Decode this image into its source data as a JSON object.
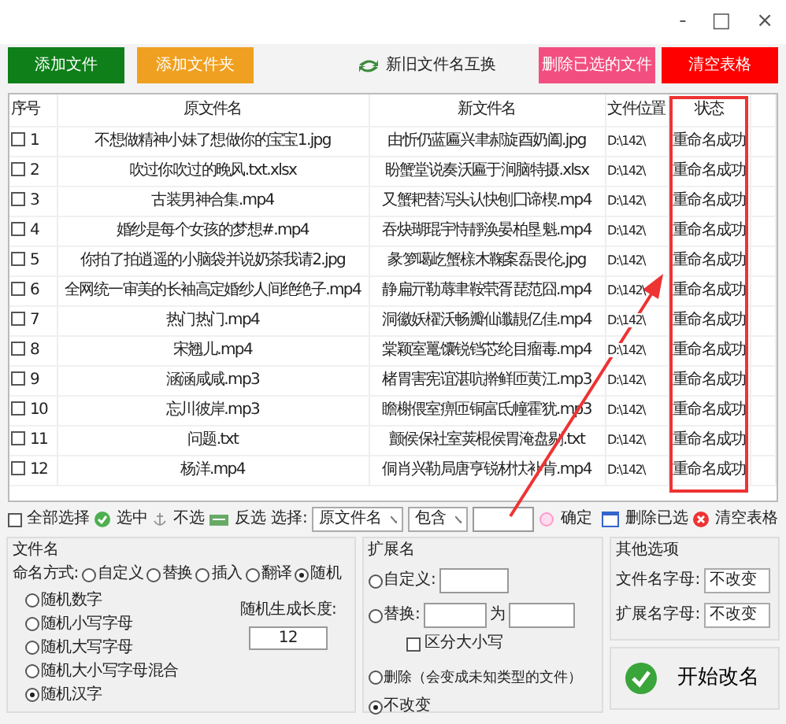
{
  "window": {
    "controls": [
      "-",
      "□",
      "×"
    ]
  },
  "top_buttons": [
    {
      "label": "添加文件",
      "kind": "green"
    },
    {
      "label": "添加文件夹",
      "kind": "orange"
    },
    {
      "label": "新旧文件名互换",
      "kind": "swap"
    },
    {
      "label": "删除已选的文件",
      "kind": "pink"
    },
    {
      "label": "清空表格",
      "kind": "red"
    }
  ],
  "table": {
    "columns": [
      "序号",
      "原文件名",
      "新文件名",
      "文件位置",
      "状态"
    ],
    "rows": [
      {
        "no": "1",
        "checked": false,
        "old": "不想做精神小妹了想做你的宝宝1.jpg",
        "new": "由忻仍蓝匾兴聿郝旋酉奶阖.jpg",
        "path": "D:\\142\\",
        "status": "重命名成功"
      },
      {
        "no": "2",
        "checked": false,
        "old": "吹过你吹过的晚风.txt.xlsx",
        "new": "盼蟹堂说奏沃匾于涧脑特摄.xlsx",
        "path": "D:\\142\\",
        "status": "重命名成功"
      },
      {
        "no": "3",
        "checked": false,
        "old": "古装男神合集.mp4",
        "new": "又蟹耙替泻头认快刨囗谛楔.mp4",
        "path": "D:\\142\\",
        "status": "重命名成功"
      },
      {
        "no": "4",
        "checked": false,
        "old": "婚纱是每个女孩的梦想#.mp4",
        "new": "吞炔瑚琨宇恃靜涣晏柏垦魁.mp4",
        "path": "D:\\142\\",
        "status": "重命名成功"
      },
      {
        "no": "5",
        "checked": false,
        "old": "你拍了拍逍遥的小脑袋并说奶茶我请2.jpg",
        "new": "彖箩噶屹蟹榇木鞠案磊畏伦.jpg",
        "path": "D:\\142\\",
        "status": "重命名成功"
      },
      {
        "no": "6",
        "checked": false,
        "old": "全网统一审美的长袖高定婚纱人间绝绝子.mp4",
        "new": "静扁亓勒蓐聿鞍茕胥琵范囧.mp4",
        "path": "D:\\142\\",
        "status": "重命名成功"
      },
      {
        "no": "7",
        "checked": false,
        "old": "热门热门.mp4",
        "new": "洞徽妖櫂沃畅瓣仙谶靚亿佳.mp4",
        "path": "D:\\142\\",
        "status": "重命名成功"
      },
      {
        "no": "8",
        "checked": false,
        "old": "宋翘儿.mp4",
        "new": "棠颖室鼍馕锐铛芯纶目瘤毒.mp4",
        "path": "D:\\142\\",
        "status": "重命名成功"
      },
      {
        "no": "9",
        "checked": false,
        "old": "涵涵咸咸.mp3",
        "new": "楮胃害宪谊湛吭擀鲜匝黄江.mp3",
        "path": "D:\\142\\",
        "status": "重命名成功"
      },
      {
        "no": "10",
        "checked": false,
        "old": "忘川彼岸.mp3",
        "new": "瞻榭偎室痹匝铜富氐幢霍犹.mp3",
        "path": "D:\\142\\",
        "status": "重命名成功"
      },
      {
        "no": "11",
        "checked": false,
        "old": "问题.txt",
        "new": "颤侯保社室荚棍侯胃淹盘剔.txt",
        "path": "D:\\142\\",
        "status": "重命名成功"
      },
      {
        "no": "12",
        "checked": false,
        "old": "杨洋.mp4",
        "new": "侗肖兴勒局唐亨锐材忕补肯.mp4",
        "path": "D:\\142\\",
        "status": "重命名成功"
      }
    ]
  },
  "toolbar": {
    "select_all": {
      "label": "全部选择",
      "checked": false
    },
    "check": "选中",
    "uncheck": "不选",
    "invert": "反选",
    "select_label": "选择:",
    "field_select": "原文件名",
    "match_select": "包含",
    "confirm": "确定",
    "delete_selected": "删除已选",
    "clear_table": "清空表格"
  },
  "filename": {
    "title": "文件名",
    "mode_label": "命名方式:",
    "modes": [
      {
        "label": "自定义",
        "selected": false
      },
      {
        "label": "替换",
        "selected": false
      },
      {
        "label": "插入",
        "selected": false
      },
      {
        "label": "翻译",
        "selected": false
      },
      {
        "label": "随机",
        "selected": true
      }
    ],
    "random_types": [
      {
        "label": "随机数字",
        "selected": false
      },
      {
        "label": "随机小写字母",
        "selected": false
      },
      {
        "label": "随机大写字母",
        "selected": false
      },
      {
        "label": "随机大小写字母混合",
        "selected": false
      },
      {
        "label": "随机汉字",
        "selected": true
      }
    ],
    "length_label": "随机生成长度:",
    "length": "12"
  },
  "extension": {
    "title": "扩展名",
    "custom": {
      "label": "自定义:",
      "selected": false
    },
    "replace": {
      "label": "替换:",
      "selected": false,
      "to": "为"
    },
    "case_sensitive": {
      "label": "区分大小写",
      "checked": false
    },
    "delete": {
      "label": "删除（会变成未知类型的文件）",
      "selected": false
    },
    "keep": {
      "label": "不改变",
      "selected": true
    }
  },
  "other": {
    "title": "其他选项",
    "name_case": {
      "label": "文件名字母:",
      "value": "不改变"
    },
    "ext_case": {
      "label": "扩展名字母:",
      "value": "不改变"
    }
  },
  "start_button": "开始改名"
}
